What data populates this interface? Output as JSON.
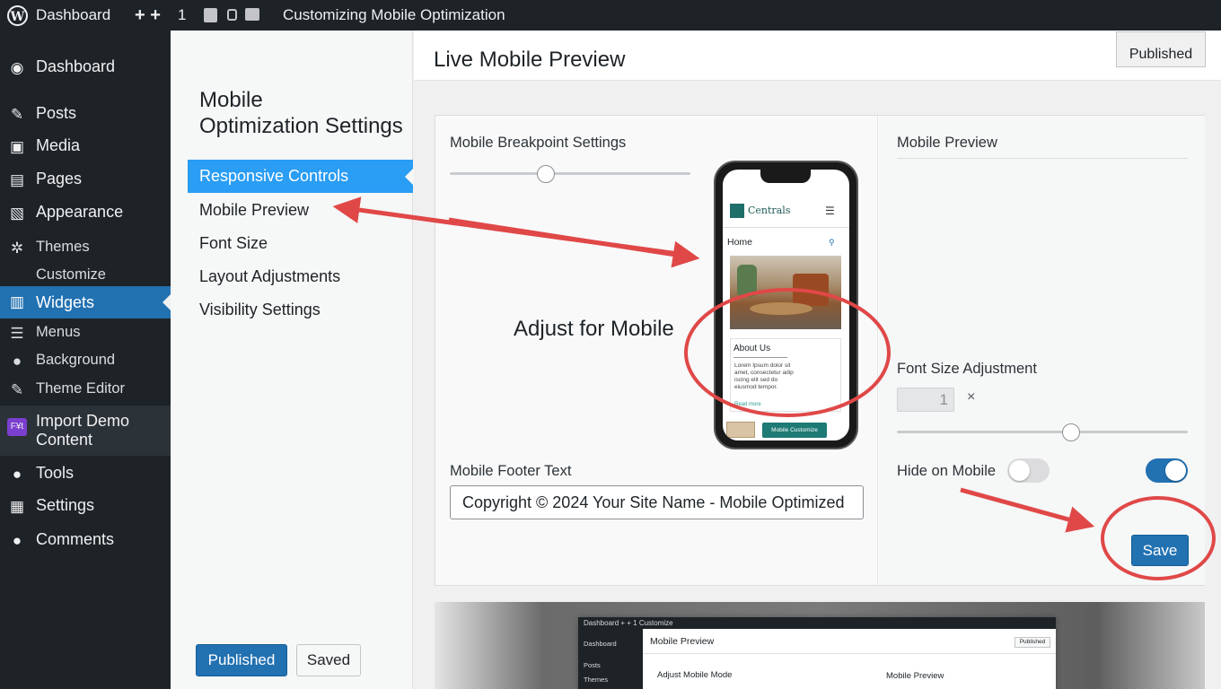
{
  "admin_bar": {
    "site_label": "Dashboard",
    "add_icons": "+ +",
    "update_count": "1",
    "page_title": "Customizing Mobile Optimization"
  },
  "sidebar": {
    "items": [
      {
        "label": "Dashboard",
        "icon": "dashboard-icon"
      },
      {
        "label": "Posts",
        "icon": "pushpin-icon"
      },
      {
        "label": "Media",
        "icon": "media-icon"
      },
      {
        "label": "Pages",
        "icon": "pages-icon"
      },
      {
        "label": "Appearance",
        "icon": "appearance-icon"
      },
      {
        "label": "Themes",
        "icon": "gear-icon"
      },
      {
        "label": "Customize"
      },
      {
        "label": "Widgets",
        "icon": "widgets-icon"
      },
      {
        "label": "Menus",
        "icon": "menus-icon"
      },
      {
        "label": "Background",
        "icon": "user-icon"
      },
      {
        "label": "Theme Editor",
        "icon": "wrench-icon"
      },
      {
        "label": "Import Demo",
        "label2": "Content",
        "icon": "import-icon",
        "icon_text": "F¥t"
      },
      {
        "label": "Tools",
        "icon": "user-icon"
      },
      {
        "label": "Settings",
        "icon": "settings-icon"
      },
      {
        "label": "Comments",
        "icon": "info-icon"
      }
    ]
  },
  "panel": {
    "title_line1": "Mobile",
    "title_line2": "Optimization Settings",
    "menu": [
      "Responsive Controls",
      "Mobile Preview",
      "Font Size",
      "Layout Adjustments",
      "Visibility Settings"
    ],
    "published_button": "Published",
    "saved_button": "Saved"
  },
  "main": {
    "title": "Live Mobile Preview",
    "published_label": "Published",
    "breakpoint_label": "Mobile Breakpoint Settings",
    "breakpoint_value": 0.4,
    "adjust_text": "Adjust for Mobile",
    "footer_label": "Mobile Footer Text",
    "footer_value": "Copyright © 2024 Your Site Name - Mobile Optimized",
    "phone": {
      "brand": "Centrals",
      "home": "Home",
      "about": "About Us",
      "lorem1": "Lorem Ipsum dolor sit",
      "lorem2": "amet, consectetur adip",
      "lorem3": "iscing elit sed do",
      "lorem4": "eiusmod tempor.",
      "read_more": "Read more",
      "cta": "Mobile Customize"
    },
    "preview_label": "Mobile Preview",
    "font_size_label": "Font Size Adjustment",
    "font_size_value": "1",
    "font_close": "×",
    "font_slider_value": 0.6,
    "hide_label": "Hide on Mobile",
    "hide_toggle_on": false,
    "second_toggle_on": true,
    "save_button": "Save"
  },
  "thumbnail": {
    "bar_text": "Dashboard  + + 1   Customize",
    "side1": "Dashboard",
    "side2": "Posts",
    "side3": "Themes",
    "title": "Mobile Preview",
    "published": "Published",
    "adjust": "Adjust Mobile Mode",
    "preview": "Mobile Preview"
  },
  "colors": {
    "admin_dark": "#1d2327",
    "accent_blue": "#2271b1",
    "annotation_red": "#e04848"
  }
}
